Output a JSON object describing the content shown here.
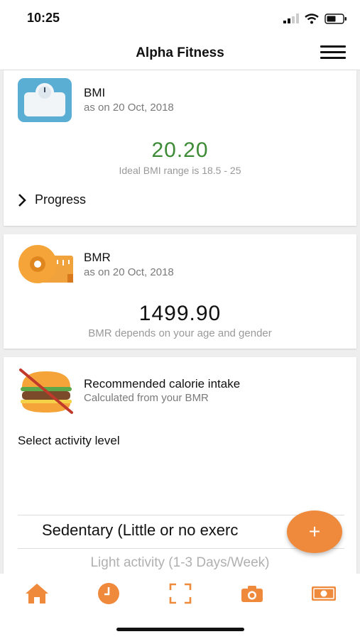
{
  "status_bar": {
    "time": "10:25"
  },
  "header": {
    "title": "Alpha Fitness",
    "menu_icon": "hamburger-menu-icon"
  },
  "bmi_card": {
    "icon": "weighing-scale-icon",
    "title": "BMI",
    "date": "as on 20 Oct, 2018",
    "value": "20.20",
    "value_color": "#3d8b37",
    "note": "Ideal BMI range is 18.5 - 25",
    "progress_label": "Progress"
  },
  "bmr_card": {
    "icon": "measuring-tape-icon",
    "title": "BMR",
    "date": "as on 20 Oct, 2018",
    "value": "1499.90",
    "note": "BMR depends on your age and gender"
  },
  "calorie_card": {
    "icon": "no-burger-icon",
    "title": "Recommended calorie intake",
    "subtitle": "Calculated from your BMR",
    "activity_label": "Select activity level",
    "options": [
      "Sedentary (Little or no exerc",
      "Light activity (1-3 Days/Week)"
    ]
  },
  "fab": {
    "label": "+"
  },
  "tab_bar": {
    "accent_color": "#ef8a3c",
    "tabs": [
      "home-icon",
      "clock-icon",
      "scan-frame-icon",
      "camera-icon",
      "money-icon"
    ]
  }
}
